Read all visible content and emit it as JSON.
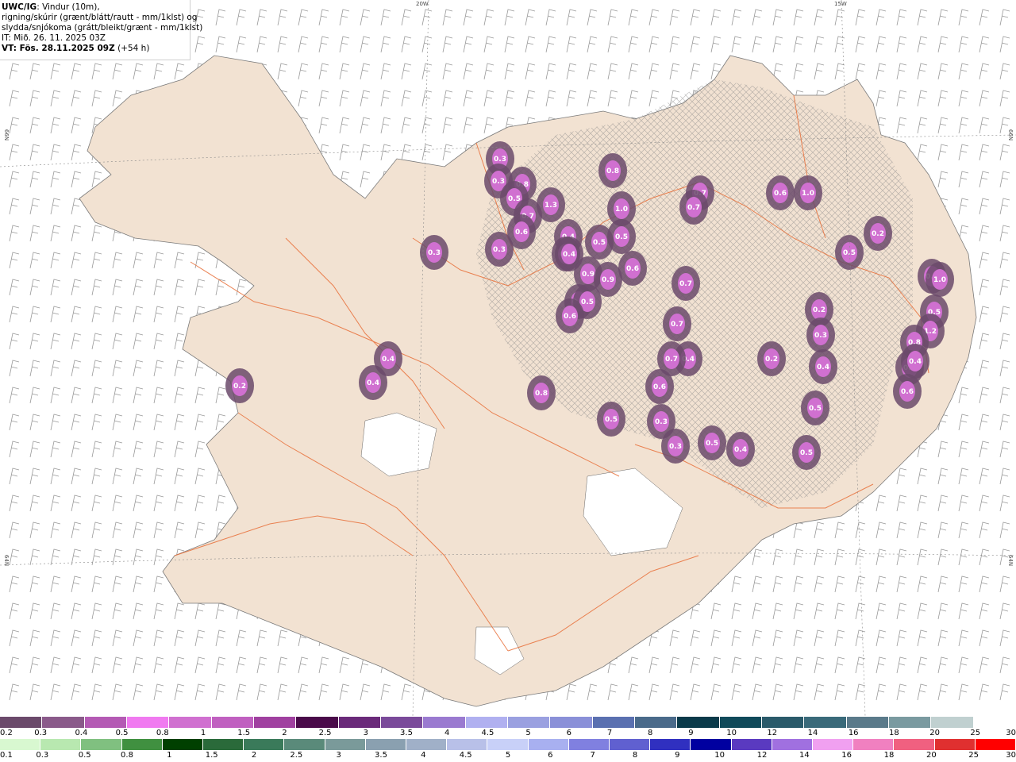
{
  "header": {
    "model": "UWC/IG",
    "line1_rest": ": Vindur (10m),",
    "line2": "rigning/skúrir (grænt/blátt/rautt - mm/1klst) og",
    "line3": "slydda/snjókoma (grátt/bleikt/grænt - mm/1klst)",
    "line4": "IT: Mið. 26. 11. 2025 03Z",
    "line5_bold": "VT: Fös. 28.11.2025 09Z",
    "line5_rest": " (+54 h)"
  },
  "grid_labels": {
    "top_left": "20W",
    "top_right": "15W",
    "left_upper": "66N",
    "left_lower": "64N",
    "right_upper": "66N",
    "right_lower": "64N"
  },
  "precip_values": [
    "0.3",
    "0.3",
    "0.8",
    "0.5",
    "0.7",
    "0.6",
    "0.3",
    "1.3",
    "0.4",
    "0.4",
    "0.4",
    "0.6",
    "0.9",
    "0.9",
    "0.8",
    "1.0",
    "0.5",
    "0.5",
    "0.5",
    "0.6",
    "0.6",
    "0.3",
    "0.4",
    "0.2",
    "0.7",
    "0.7",
    "0.7",
    "0.7",
    "0.4",
    "0.7",
    "0.6",
    "0.3",
    "0.3",
    "0.5",
    "0.4",
    "0.5",
    "0.8",
    "0.5",
    "0.4",
    "0.4",
    "0.2",
    "0.5",
    "1.0",
    "0.6",
    "0.2",
    "0.3",
    "0.4",
    "0.5",
    "1.0",
    "1.2",
    "0.8",
    "0.8",
    "0.6",
    "0.4",
    "0.5",
    "0.2"
  ],
  "legend": {
    "snow_colors": [
      "#6b4a6b",
      "#8a5a8a",
      "#b45ab4",
      "#f07af0",
      "#d070d0",
      "#c060c0",
      "#a040a0",
      "#4a0a4a",
      "#6a2a7a",
      "#7a4a9a",
      "#9a7ad0",
      "#b0b0f0",
      "#9aa0e0",
      "#8a90d8",
      "#5a70b0",
      "#4a6a8a",
      "#0a3a4a",
      "#104a5a",
      "#2a5a6a",
      "#3a6a7a",
      "#5a7a8a",
      "#7a9aa0",
      "#c0d0d0",
      "#ffffff"
    ],
    "snow_ticks": [
      "0.2",
      "0.3",
      "0.4",
      "0.5",
      "0.8",
      "1",
      "1.5",
      "2",
      "2.5",
      "3",
      "3.5",
      "4",
      "4.5",
      "5",
      "6",
      "7",
      "8",
      "9",
      "10",
      "12",
      "14",
      "16",
      "18",
      "20",
      "25",
      "30"
    ],
    "rain_colors": [
      "#d8f8d0",
      "#b8e8b0",
      "#80c080",
      "#409040",
      "#004000",
      "#2a6a3a",
      "#3a7a5a",
      "#5a8a7a",
      "#7a9a9a",
      "#8aa0b0",
      "#a0b0c8",
      "#b8c0e8",
      "#c8d0f8",
      "#a8b0f0",
      "#8080e0",
      "#6060d0",
      "#3030c0",
      "#0000a0",
      "#5a3ac0",
      "#a070e0",
      "#f0a0f0",
      "#f080c0",
      "#f06080",
      "#e03030",
      "#ff0000"
    ],
    "rain_ticks": [
      "0.1",
      "0.3",
      "0.5",
      "0.8",
      "1",
      "1.5",
      "2",
      "2.5",
      "3",
      "3.5",
      "4",
      "4.5",
      "5",
      "6",
      "7",
      "8",
      "9",
      "10",
      "12",
      "14",
      "16",
      "18",
      "20",
      "25",
      "30"
    ]
  },
  "colors": {
    "land": "#f2e2d2",
    "road": "#e8703a",
    "sea": "#ffffff",
    "barb": "#9a9a9a"
  }
}
